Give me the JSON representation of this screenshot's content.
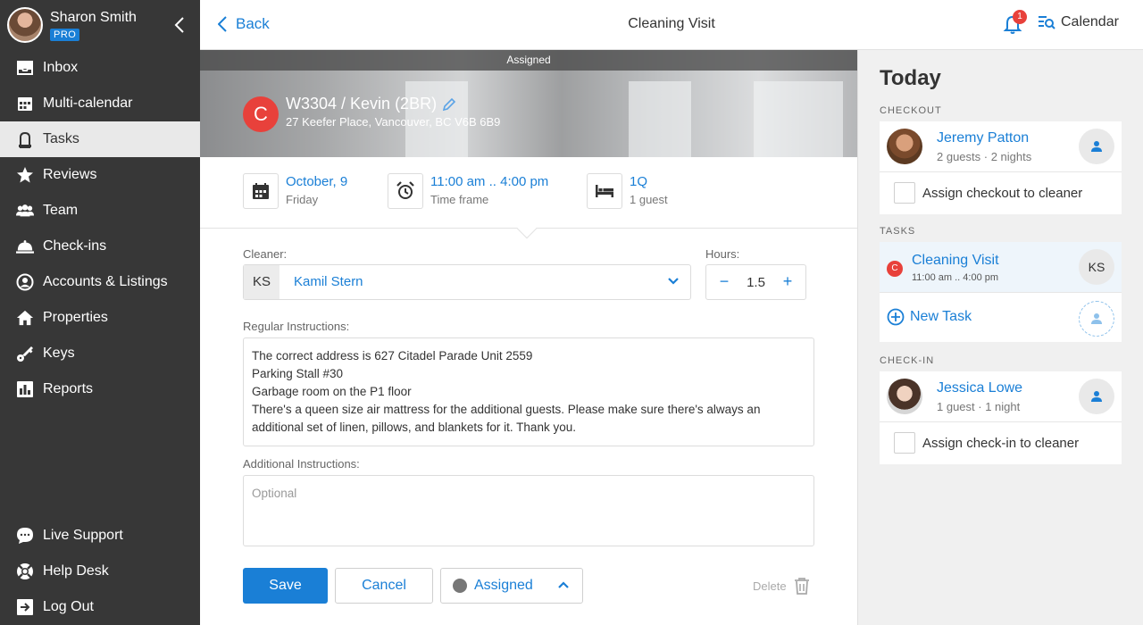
{
  "user": {
    "name": "Sharon Smith",
    "badge": "PRO"
  },
  "nav": {
    "items": [
      {
        "label": "Inbox",
        "icon": "inbox-icon"
      },
      {
        "label": "Multi-calendar",
        "icon": "calendar-icon"
      },
      {
        "label": "Tasks",
        "icon": "tasks-icon",
        "active": true
      },
      {
        "label": "Reviews",
        "icon": "star-icon"
      },
      {
        "label": "Team",
        "icon": "team-icon"
      },
      {
        "label": "Check-ins",
        "icon": "bell-service-icon"
      },
      {
        "label": "Accounts & Listings",
        "icon": "account-icon"
      },
      {
        "label": "Properties",
        "icon": "home-icon"
      },
      {
        "label": "Keys",
        "icon": "key-icon"
      },
      {
        "label": "Reports",
        "icon": "reports-icon"
      }
    ],
    "bottom": [
      {
        "label": "Live Support",
        "icon": "chat-icon"
      },
      {
        "label": "Help Desk",
        "icon": "lifebuoy-icon"
      },
      {
        "label": "Log Out",
        "icon": "logout-icon"
      }
    ]
  },
  "header": {
    "back_label": "Back",
    "title": "Cleaning Visit",
    "notification_count": "1",
    "calendar_label": "Calendar"
  },
  "task": {
    "status_banner": "Assigned",
    "property_initial": "C",
    "property_title": "W3304 / Kevin (2BR)",
    "property_address": "27 Keefer Place, Vancouver, BC V6B 6B9",
    "date": "October, 9",
    "weekday": "Friday",
    "time": "11:00 am .. 4:00 pm",
    "time_label": "Time frame",
    "beds": "1Q",
    "guests": "1 guest"
  },
  "form": {
    "cleaner_label": "Cleaner:",
    "cleaner_initials": "KS",
    "cleaner_name": "Kamil Stern",
    "hours_label": "Hours:",
    "hours_minus": "−",
    "hours_value": "1.5",
    "hours_plus": "+",
    "regular_label": "Regular Instructions:",
    "regular_lines": [
      "The correct address is 627 Citadel Parade Unit 2559",
      "Parking Stall #30",
      "Garbage room on the P1 floor",
      "There's a queen size air mattress for the additional guests. Please make sure there's always an additional set of linen, pillows, and blankets for it. Thank you."
    ],
    "additional_label": "Additional Instructions:",
    "additional_placeholder": "Optional",
    "save_label": "Save",
    "cancel_label": "Cancel",
    "status_label": "Assigned",
    "delete_label": "Delete"
  },
  "today": {
    "title": "Today",
    "checkout_header": "CHECKOUT",
    "checkout_guest": "Jeremy Patton",
    "checkout_sub": "2 guests · 2 nights",
    "checkout_assign_label": "Assign checkout to cleaner",
    "tasks_header": "TASKS",
    "task_initial": "C",
    "task_title": "Cleaning Visit",
    "task_time": "11:00 am .. 4:00 pm",
    "task_assignee": "KS",
    "new_task_label": "New Task",
    "checkin_header": "CHECK-IN",
    "checkin_guest": "Jessica Lowe",
    "checkin_sub": "1 guest · 1 night",
    "checkin_assign_label": "Assign check-in to cleaner"
  },
  "colors": {
    "accent": "#1a7fd6",
    "sidebar": "#373737",
    "badge_red": "#e8413b"
  }
}
